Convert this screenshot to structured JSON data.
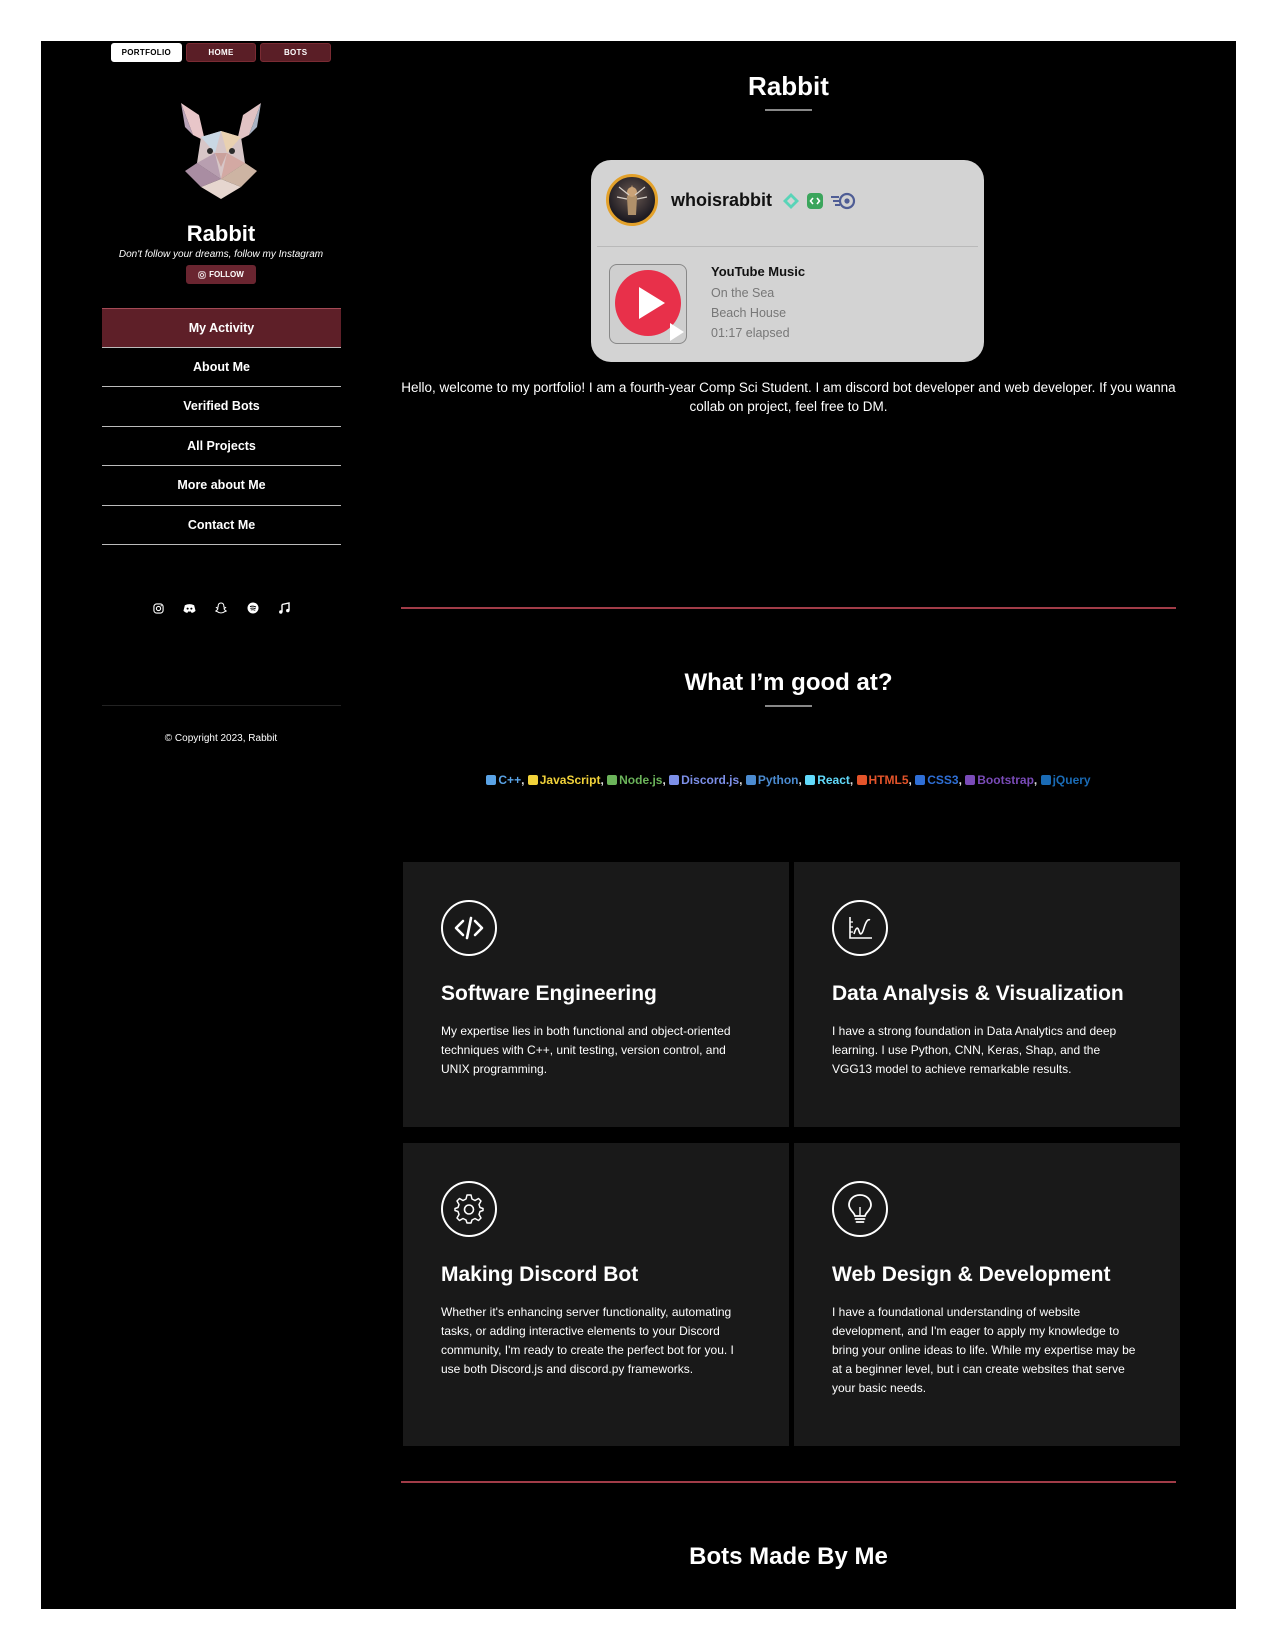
{
  "topnav": {
    "items": [
      "PORTFOLIO",
      "HOME",
      "BOTS"
    ]
  },
  "profile": {
    "name": "Rabbit",
    "tagline": "Don't follow your dreams, follow my Instagram",
    "follow_label": "FOLLOW"
  },
  "menu": {
    "items": [
      "My Activity",
      "About Me",
      "Verified Bots",
      "All Projects",
      "More about Me",
      "Contact Me"
    ],
    "active": "My Activity"
  },
  "socials": [
    "instagram-icon",
    "discord-icon",
    "snapchat-icon",
    "spotify-icon",
    "music-note-icon"
  ],
  "footer": {
    "copyright": "Copyright 2023, Rabbit"
  },
  "main": {
    "title": "Rabbit",
    "status_card": {
      "username": "whoisrabbit",
      "badges": [
        "hypesquad-icon",
        "developer-badge-icon",
        "nitro-icon"
      ],
      "activity_app": "YouTube Music",
      "track": "On the Sea",
      "artist": "Beach House",
      "elapsed": "01:17 elapsed"
    },
    "intro": "Hello, welcome to my portfolio! I am a fourth-year Comp Sci Student. I am discord bot developer and web developer. If you wanna collab on project, feel free to DM.",
    "skills_title": "What I’m good at?",
    "skills": [
      {
        "label": "C++",
        "color": "#5aa3e6"
      },
      {
        "label": "JavaScript",
        "color": "#f1d23a"
      },
      {
        "label": "Node.js",
        "color": "#6bb35a"
      },
      {
        "label": "Discord.js",
        "color": "#7c8fe8"
      },
      {
        "label": "Python",
        "color": "#4b8bd0"
      },
      {
        "label": "React",
        "color": "#61dafb"
      },
      {
        "label": "HTML5",
        "color": "#e4542a"
      },
      {
        "label": "CSS3",
        "color": "#2f6fd6"
      },
      {
        "label": "Bootstrap",
        "color": "#7a4bb8"
      },
      {
        "label": "jQuery",
        "color": "#1a6bb5"
      }
    ],
    "services": [
      {
        "icon": "code-icon",
        "title": "Software Engineering",
        "body": "My expertise lies in both functional and object-oriented techniques with C++, unit testing, version control, and UNIX programming."
      },
      {
        "icon": "chart-icon",
        "title": "Data Analysis & Visualization",
        "body": "I have a strong foundation in Data Analytics and deep learning. I use Python, CNN, Keras, Shap, and the VGG13 model to achieve remarkable results."
      },
      {
        "icon": "gear-icon",
        "title": "Making Discord Bot",
        "body": "Whether it's enhancing server functionality, automating tasks, or adding interactive elements to your Discord community, I'm ready to create the perfect bot for you. I use both Discord.js and discord.py frameworks."
      },
      {
        "icon": "lightbulb-icon",
        "title": "Web Design & Development",
        "body": "I have a foundational understanding of website development, and I'm eager to apply my knowledge to bring your online ideas to life. While my expertise may be at a beginner level, but i can create websites that serve your basic needs."
      }
    ],
    "bots_title": "Bots Made By Me"
  }
}
